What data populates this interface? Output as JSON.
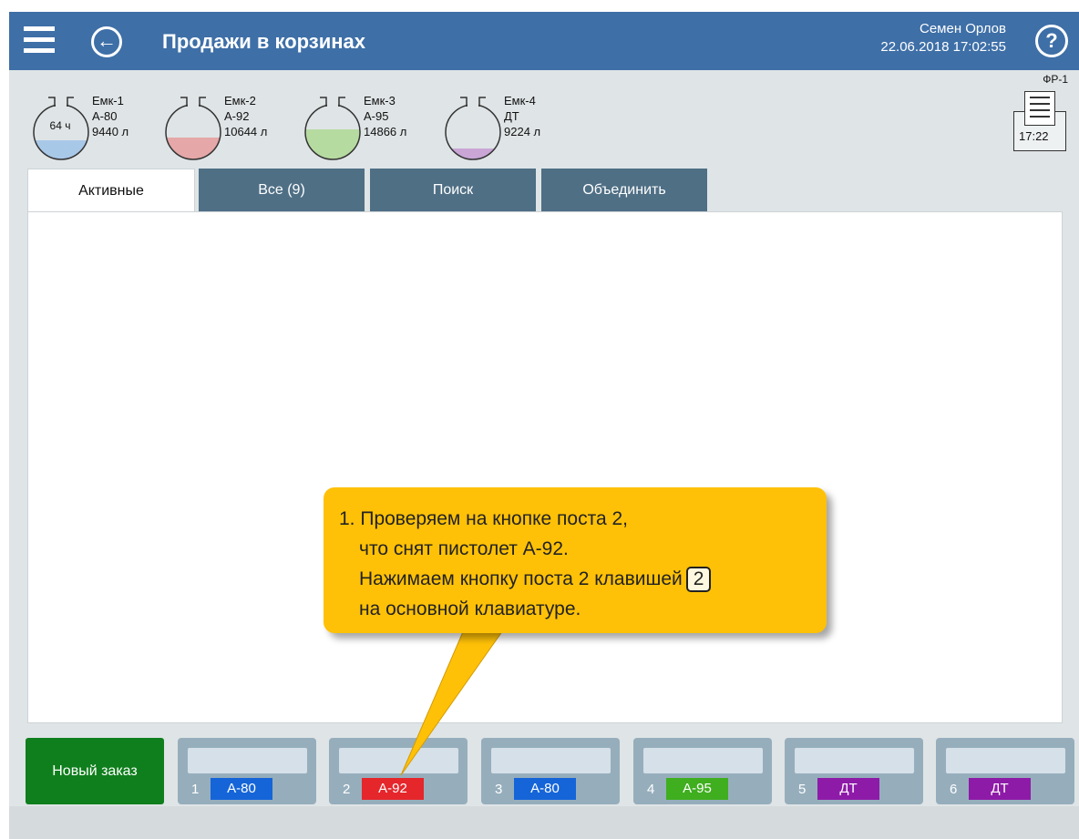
{
  "header": {
    "title": "Продажи в корзинах",
    "user_name": "Семен Орлов",
    "datetime": "22.06.2018 17:02:55",
    "help_label": "?",
    "back_label": "←"
  },
  "tanks": [
    {
      "name": "Емк-1",
      "fuel": "А-80",
      "volume": "9440 л",
      "hours": "64 ч",
      "fill_fraction": 0.35,
      "color": "#a8c8e8"
    },
    {
      "name": "Емк-2",
      "fuel": "А-92",
      "volume": "10644 л",
      "hours": "",
      "fill_fraction": 0.4,
      "color": "#e5a7a8"
    },
    {
      "name": "Емк-3",
      "fuel": "А-95",
      "volume": "14866 л",
      "hours": "",
      "fill_fraction": 0.55,
      "color": "#b6dba0"
    },
    {
      "name": "Емк-4",
      "fuel": "ДТ",
      "volume": "9224 л",
      "hours": "",
      "fill_fraction": 0.2,
      "color": "#c9a6d6"
    }
  ],
  "fiscal": {
    "name": "ФР-1",
    "time": "17:22"
  },
  "tabs": [
    {
      "label": "Активные",
      "active": true
    },
    {
      "label": "Все (9)",
      "active": false
    },
    {
      "label": "Поиск",
      "active": false
    },
    {
      "label": "Объединить",
      "active": false
    }
  ],
  "new_order_label": "Новый заказ",
  "posts": [
    {
      "number": "1",
      "fuel": "А-80",
      "color": "#1565d8"
    },
    {
      "number": "2",
      "fuel": "А-92",
      "color": "#e5262b"
    },
    {
      "number": "3",
      "fuel": "А-80",
      "color": "#1565d8"
    },
    {
      "number": "4",
      "fuel": "А-95",
      "color": "#3fae1f"
    },
    {
      "number": "5",
      "fuel": "ДТ",
      "color": "#8e1aa8"
    },
    {
      "number": "6",
      "fuel": "ДТ",
      "color": "#8e1aa8"
    }
  ],
  "callout": {
    "line1": "1. Проверяем на кнопке поста 2,",
    "line2": "что снят пистолет А-92.",
    "line3": "Нажимаем кнопку поста 2 клавишей",
    "key": "2",
    "line4": "на основной клавиатуре."
  },
  "colors": {
    "header": "#3e6fa7",
    "callout": "#ffc107",
    "new_order": "#0f7f1d",
    "post_bg": "#96aebc"
  }
}
